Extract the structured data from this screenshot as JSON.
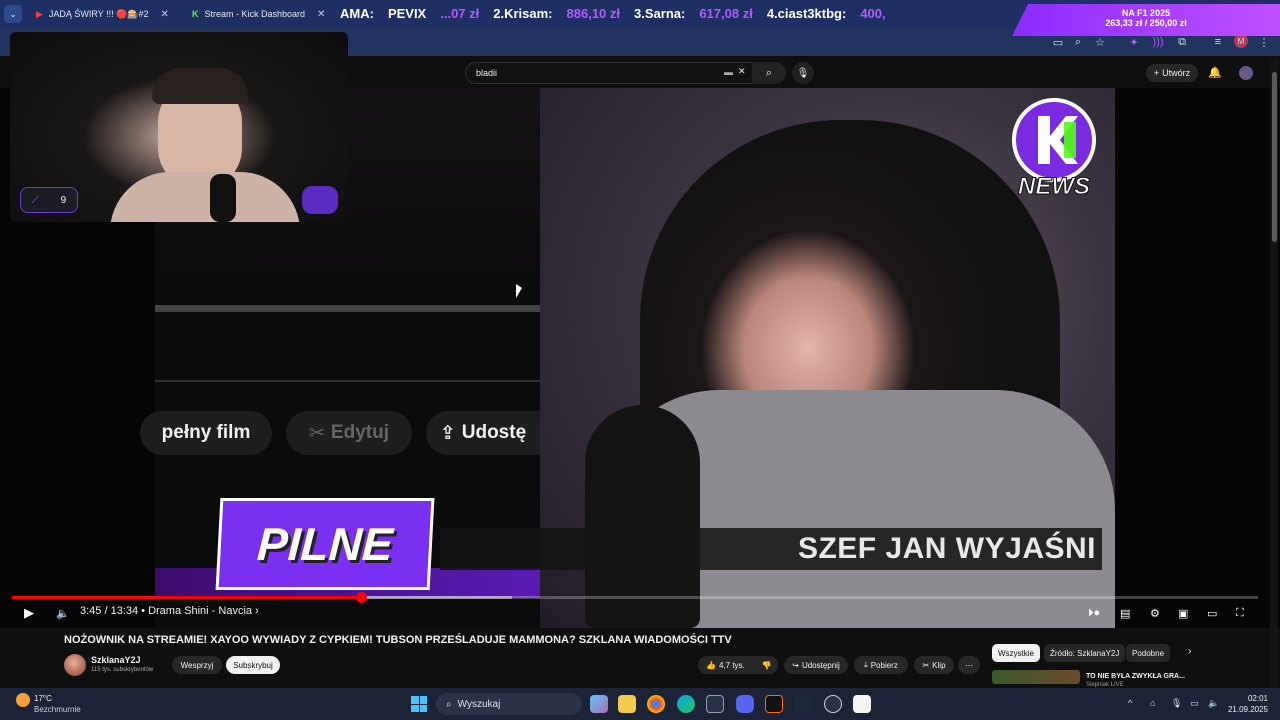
{
  "browser": {
    "tabs": [
      {
        "label": "JADĄ ŚWIRY !!! 🔴🎰#2",
        "icon": "youtube-icon"
      },
      {
        "label": "Stream - Kick Dashboard",
        "icon": "kick-icon"
      }
    ]
  },
  "overlay": {
    "leaderboard": [
      {
        "rank_name": "AMA:",
        "value": ""
      },
      {
        "rank_name": "PEVIX",
        "value": "...07 zł"
      },
      {
        "rank_name": "2.Krisam:",
        "value": "886,10 zł"
      },
      {
        "rank_name": "3.Sarna:",
        "value": "617,08 zł"
      },
      {
        "rank_name": "4.ciast3ktbg:",
        "value": "400,"
      }
    ],
    "goal": {
      "title": "NA F1 2025",
      "progress": "263,33 zł / 250,00 zł"
    },
    "facecam_chip_count": "9",
    "pilne_label": "PILNE",
    "ticker_text": "SZEF JAN WYJAŚNI",
    "news_label": "NEWS",
    "pills": [
      {
        "icon": "film-icon",
        "label": "pełny film"
      },
      {
        "icon": "scissors-icon",
        "label": "Edytuj"
      },
      {
        "icon": "upload-icon",
        "label": "Udostę"
      }
    ]
  },
  "youtube": {
    "search_value": "bladii",
    "create_label": "Utwórz",
    "player": {
      "time": "3:45 / 13:34",
      "chapter": "• Drama Shini - Navcia ›",
      "progress_fraction": 0.28
    },
    "video_title": "NOŻOWNIK NA STREAMIE! XAYOO WYWIADY Z CYPKIEM! TUBSON PRZEŚLADUJE MAMMONA? SZKLANA WIADOMOŚCI TTV",
    "channel": {
      "name": "SzklanaY2J",
      "subs": "115 tys. subskrybentów"
    },
    "buttons": {
      "support": "Wesprzyj",
      "subscribe": "Subskrybuj",
      "likes": "4,7 tys.",
      "share": "Udostępnij",
      "download": "Pobierz",
      "clip": "Klip"
    },
    "chips": [
      "Wszystkie",
      "Źródło: SzklanaY2J",
      "Podobne"
    ],
    "recommendation": {
      "title": "TO NIE BYŁA ZWYKŁA GRA...",
      "sub": "Siepniak LIVE"
    }
  },
  "taskbar": {
    "weather_temp": "17°C",
    "weather_desc": "Bezchmurnie",
    "search_placeholder": "Wyszukaj",
    "time": "02:01",
    "date": "21.09.2025"
  },
  "colors": {
    "accent_purple": "#8b2cff",
    "progress_red": "#ff0000",
    "leader_value": "#b25cff"
  }
}
